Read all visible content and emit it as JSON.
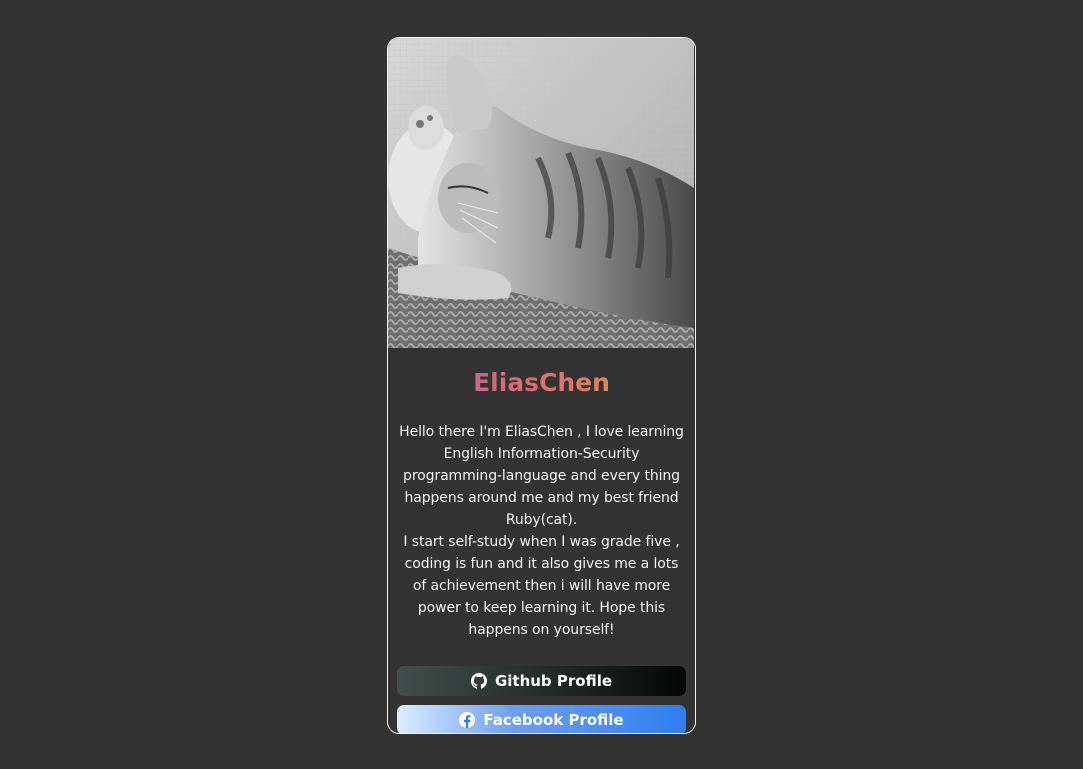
{
  "profile": {
    "name": "EliasChen",
    "bio_lines": [
      "Hello there I'm EliasChen , I love learning English Information-Security programming-language and every thing happens around me and my best friend Ruby(cat).",
      "I start self-study when I was grade five , coding is fun and it also gives me a lots of achievement then i will have more power to keep learning it. Hope this happens on yourself!"
    ]
  },
  "buttons": {
    "github_label": "Github Profile",
    "facebook_label": "Facebook Profile"
  },
  "icons": {
    "github": "github-icon",
    "facebook": "facebook-icon"
  },
  "colors": {
    "page_background": "#333333",
    "card_border": "#f2f2f2",
    "name_gradient": [
      "#c05bb0",
      "#d6706f",
      "#e7a33e"
    ],
    "github_button": [
      "#434f4c",
      "#050606"
    ],
    "facebook_button": [
      "#dcecff",
      "#2f7ef0"
    ],
    "text": "#f4f4f4"
  }
}
